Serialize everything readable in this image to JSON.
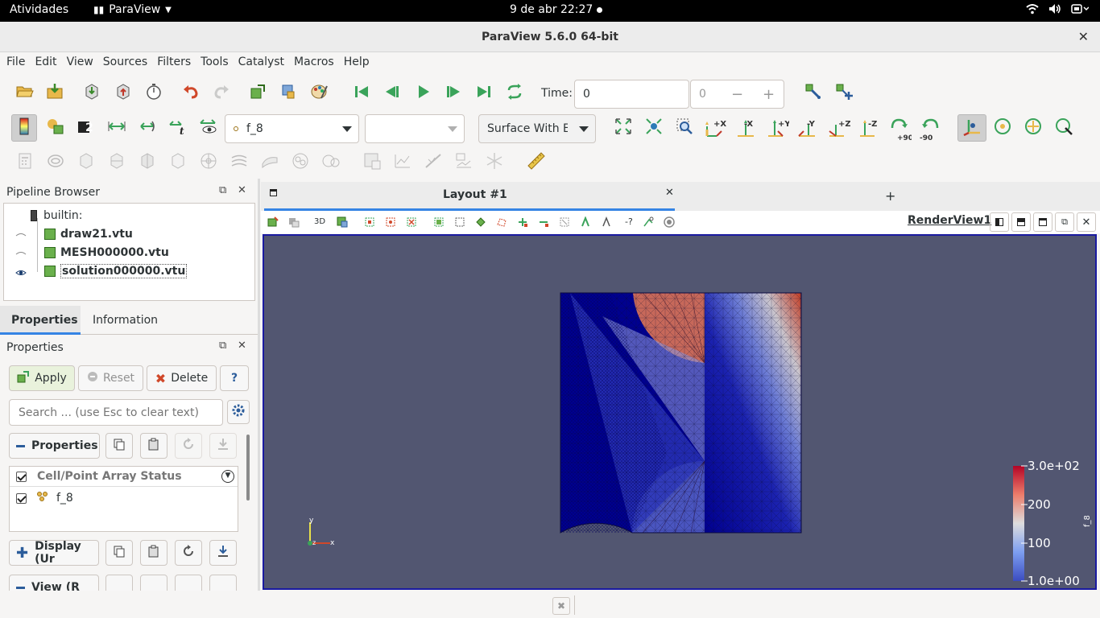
{
  "system_bar": {
    "activities": "Atividades",
    "app_name": "ParaView",
    "clock": "9 de abr  22:27"
  },
  "window": {
    "title": "ParaView 5.6.0 64-bit"
  },
  "menu": [
    "File",
    "Edit",
    "View",
    "Sources",
    "Filters",
    "Tools",
    "Catalyst",
    "Macros",
    "Help"
  ],
  "time": {
    "label": "Time:",
    "value": "0",
    "index": "0"
  },
  "toolbar": {
    "color_by": "f_8",
    "component": "",
    "representation": "Surface With E",
    "axes": [
      "+X",
      "-X",
      "+Y",
      "-Y",
      "+Z",
      "-Z"
    ],
    "rotate_cw": "+90",
    "rotate_ccw": "-90"
  },
  "pipeline": {
    "title": "Pipeline Browser",
    "root": "builtin:",
    "items": [
      {
        "name": "draw21.vtu",
        "visible": false
      },
      {
        "name": "MESH000000.vtu",
        "visible": false
      },
      {
        "name": "solution000000.vtu",
        "visible": true
      }
    ]
  },
  "tabs": {
    "properties": "Properties",
    "information": "Information"
  },
  "properties": {
    "title": "Properties",
    "apply": "Apply",
    "reset": "Reset",
    "delete": "Delete",
    "help": "?",
    "search_placeholder": "Search ... (use Esc to clear text)",
    "section_properties": "Properties",
    "array_status_header": "Cell/Point Array Status",
    "arrays": [
      "f_8"
    ],
    "section_display": "Display (Ur",
    "section_view": "View (R"
  },
  "layout": {
    "tab_title": "Layout #1",
    "add_tab": "+",
    "view_name": "RenderView1",
    "view_toolbar_3d": "3D"
  },
  "colorbar": {
    "title": "f_8",
    "labels": [
      "3.0e+02",
      "200",
      "100",
      "1.0e+00"
    ]
  },
  "axes_triad": {
    "x": "x",
    "y": "y",
    "z": "z"
  },
  "colors": {
    "background": "#525671",
    "accent": "#3584e4",
    "mesh_low": "#00008f",
    "mesh_high": "#c23b22"
  }
}
